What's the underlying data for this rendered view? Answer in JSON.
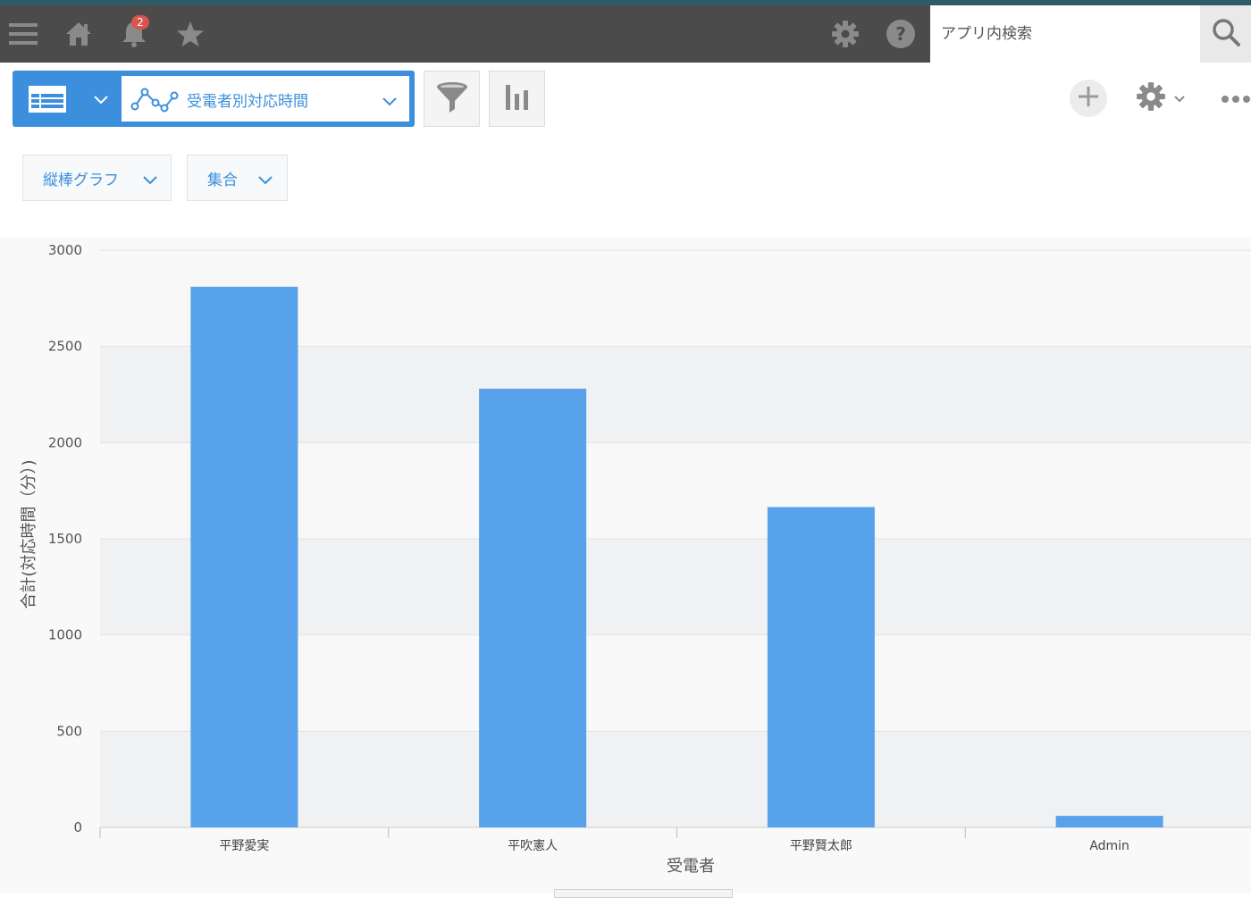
{
  "header": {
    "notification_count": "2",
    "search_placeholder": "アプリ内検索"
  },
  "icons": {
    "menu": "menu-icon",
    "home": "home-icon",
    "notifications": "bell-icon",
    "favorites": "star-icon",
    "settings": "gear-icon",
    "help": "help-icon",
    "search": "search-icon",
    "list_view": "table-icon",
    "graph": "line-graph-icon",
    "filter": "funnel-icon",
    "graph_settings": "bar-chart-icon",
    "add": "plus-icon",
    "app_settings": "gear-icon",
    "more": "more-icon"
  },
  "toolbar": {
    "view_name": "受電者別対応時間"
  },
  "dropdowns": {
    "chart_type": "縦棒グラフ",
    "aggregation": "集合"
  },
  "colors": {
    "accent": "#3b8fdc",
    "bar": "#57a2ea",
    "header_bg": "#4b4b4b",
    "badge": "#d9534f"
  },
  "chart_data": {
    "type": "bar",
    "categories": [
      "平野愛実",
      "平吹憲人",
      "平野賢太郎",
      "Admin"
    ],
    "values": [
      2810,
      2280,
      1665,
      60
    ],
    "xlabel": "受電者",
    "ylabel": "合計(対応時間（分）)",
    "ylim": [
      0,
      3000
    ],
    "yticks": [
      0,
      500,
      1000,
      1500,
      2000,
      2500,
      3000
    ],
    "grid": true,
    "legend": "none"
  }
}
